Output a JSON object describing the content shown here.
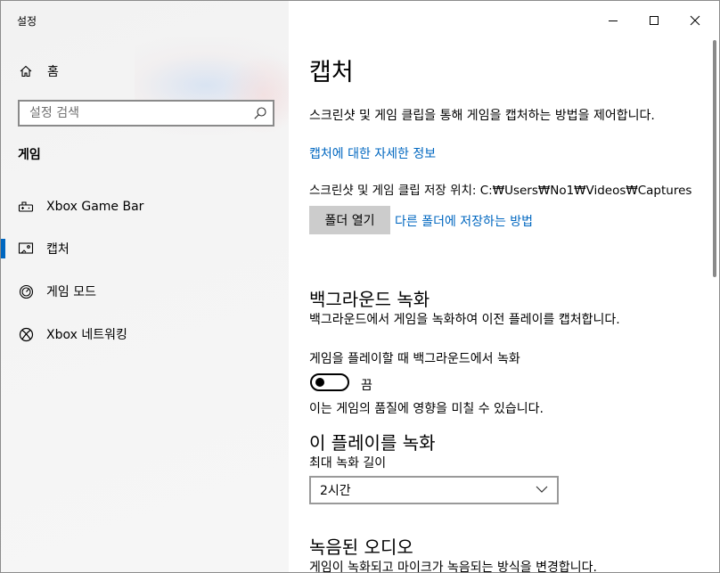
{
  "window": {
    "app_title": "설정",
    "minimize_icon": "minimize-icon",
    "maximize_icon": "maximize-icon",
    "close_icon": "close-icon"
  },
  "sidebar": {
    "home_label": "홈",
    "search_placeholder": "설정 검색",
    "section_title": "게임",
    "items": [
      {
        "label": "Xbox Game Bar",
        "icon": "gamepad-icon",
        "active": false
      },
      {
        "label": "캡처",
        "icon": "capture-icon",
        "active": true
      },
      {
        "label": "게임 모드",
        "icon": "gauge-icon",
        "active": false
      },
      {
        "label": "Xbox 네트워킹",
        "icon": "xbox-icon",
        "active": false
      }
    ]
  },
  "main": {
    "title": "캡처",
    "description": "스크린샷 및 게임 클립을 통해 게임을 캡처하는 방법을 제어합니다.",
    "more_info_link": "캡처에 대한 자세한 정보",
    "save_location": "스크린샷 및 게임 클립 저장 위치: C:₩Users₩No1₩Videos₩Captures",
    "open_folder_button": "폴더 열기",
    "other_folder_link": "다른 폴더에 저장하는 방법",
    "background_recording": {
      "heading": "백그라운드 녹화",
      "description": "백그라운드에서 게임을 녹화하여 이전 플레이를 캡처합니다.",
      "toggle_label": "게임을 플레이할 때 백그라운드에서 녹화",
      "toggle_state": "끔",
      "toggle_on": false,
      "note": "이는 게임의 품질에 영향을 미칠 수 있습니다."
    },
    "record_that": {
      "heading": "이 플레이를 녹화",
      "max_length_label": "최대 녹화 길이",
      "max_length_value": "2시간"
    },
    "recorded_audio": {
      "heading": "녹음된 오디오",
      "description": "게임이 녹화되고 마이크가 녹음되는 방식을 변경합니다."
    }
  },
  "colors": {
    "accent": "#0067c0",
    "button_bg": "#cccccc",
    "sidebar_bg": "#f3f3f3"
  }
}
